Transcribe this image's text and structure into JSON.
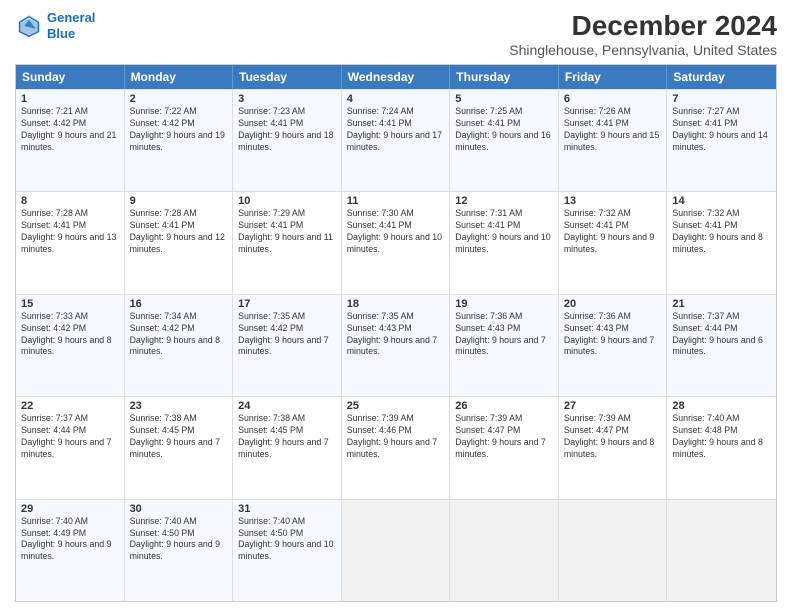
{
  "header": {
    "logo_line1": "General",
    "logo_line2": "Blue",
    "title": "December 2024",
    "subtitle": "Shinglehouse, Pennsylvania, United States"
  },
  "weekdays": [
    "Sunday",
    "Monday",
    "Tuesday",
    "Wednesday",
    "Thursday",
    "Friday",
    "Saturday"
  ],
  "weeks": [
    [
      {
        "day": "1",
        "sunrise": "Sunrise: 7:21 AM",
        "sunset": "Sunset: 4:42 PM",
        "daylight": "Daylight: 9 hours and 21 minutes."
      },
      {
        "day": "2",
        "sunrise": "Sunrise: 7:22 AM",
        "sunset": "Sunset: 4:42 PM",
        "daylight": "Daylight: 9 hours and 19 minutes."
      },
      {
        "day": "3",
        "sunrise": "Sunrise: 7:23 AM",
        "sunset": "Sunset: 4:41 PM",
        "daylight": "Daylight: 9 hours and 18 minutes."
      },
      {
        "day": "4",
        "sunrise": "Sunrise: 7:24 AM",
        "sunset": "Sunset: 4:41 PM",
        "daylight": "Daylight: 9 hours and 17 minutes."
      },
      {
        "day": "5",
        "sunrise": "Sunrise: 7:25 AM",
        "sunset": "Sunset: 4:41 PM",
        "daylight": "Daylight: 9 hours and 16 minutes."
      },
      {
        "day": "6",
        "sunrise": "Sunrise: 7:26 AM",
        "sunset": "Sunset: 4:41 PM",
        "daylight": "Daylight: 9 hours and 15 minutes."
      },
      {
        "day": "7",
        "sunrise": "Sunrise: 7:27 AM",
        "sunset": "Sunset: 4:41 PM",
        "daylight": "Daylight: 9 hours and 14 minutes."
      }
    ],
    [
      {
        "day": "8",
        "sunrise": "Sunrise: 7:28 AM",
        "sunset": "Sunset: 4:41 PM",
        "daylight": "Daylight: 9 hours and 13 minutes."
      },
      {
        "day": "9",
        "sunrise": "Sunrise: 7:28 AM",
        "sunset": "Sunset: 4:41 PM",
        "daylight": "Daylight: 9 hours and 12 minutes."
      },
      {
        "day": "10",
        "sunrise": "Sunrise: 7:29 AM",
        "sunset": "Sunset: 4:41 PM",
        "daylight": "Daylight: 9 hours and 11 minutes."
      },
      {
        "day": "11",
        "sunrise": "Sunrise: 7:30 AM",
        "sunset": "Sunset: 4:41 PM",
        "daylight": "Daylight: 9 hours and 10 minutes."
      },
      {
        "day": "12",
        "sunrise": "Sunrise: 7:31 AM",
        "sunset": "Sunset: 4:41 PM",
        "daylight": "Daylight: 9 hours and 10 minutes."
      },
      {
        "day": "13",
        "sunrise": "Sunrise: 7:32 AM",
        "sunset": "Sunset: 4:41 PM",
        "daylight": "Daylight: 9 hours and 9 minutes."
      },
      {
        "day": "14",
        "sunrise": "Sunrise: 7:32 AM",
        "sunset": "Sunset: 4:41 PM",
        "daylight": "Daylight: 9 hours and 8 minutes."
      }
    ],
    [
      {
        "day": "15",
        "sunrise": "Sunrise: 7:33 AM",
        "sunset": "Sunset: 4:42 PM",
        "daylight": "Daylight: 9 hours and 8 minutes."
      },
      {
        "day": "16",
        "sunrise": "Sunrise: 7:34 AM",
        "sunset": "Sunset: 4:42 PM",
        "daylight": "Daylight: 9 hours and 8 minutes."
      },
      {
        "day": "17",
        "sunrise": "Sunrise: 7:35 AM",
        "sunset": "Sunset: 4:42 PM",
        "daylight": "Daylight: 9 hours and 7 minutes."
      },
      {
        "day": "18",
        "sunrise": "Sunrise: 7:35 AM",
        "sunset": "Sunset: 4:43 PM",
        "daylight": "Daylight: 9 hours and 7 minutes."
      },
      {
        "day": "19",
        "sunrise": "Sunrise: 7:36 AM",
        "sunset": "Sunset: 4:43 PM",
        "daylight": "Daylight: 9 hours and 7 minutes."
      },
      {
        "day": "20",
        "sunrise": "Sunrise: 7:36 AM",
        "sunset": "Sunset: 4:43 PM",
        "daylight": "Daylight: 9 hours and 7 minutes."
      },
      {
        "day": "21",
        "sunrise": "Sunrise: 7:37 AM",
        "sunset": "Sunset: 4:44 PM",
        "daylight": "Daylight: 9 hours and 6 minutes."
      }
    ],
    [
      {
        "day": "22",
        "sunrise": "Sunrise: 7:37 AM",
        "sunset": "Sunset: 4:44 PM",
        "daylight": "Daylight: 9 hours and 7 minutes."
      },
      {
        "day": "23",
        "sunrise": "Sunrise: 7:38 AM",
        "sunset": "Sunset: 4:45 PM",
        "daylight": "Daylight: 9 hours and 7 minutes."
      },
      {
        "day": "24",
        "sunrise": "Sunrise: 7:38 AM",
        "sunset": "Sunset: 4:45 PM",
        "daylight": "Daylight: 9 hours and 7 minutes."
      },
      {
        "day": "25",
        "sunrise": "Sunrise: 7:39 AM",
        "sunset": "Sunset: 4:46 PM",
        "daylight": "Daylight: 9 hours and 7 minutes."
      },
      {
        "day": "26",
        "sunrise": "Sunrise: 7:39 AM",
        "sunset": "Sunset: 4:47 PM",
        "daylight": "Daylight: 9 hours and 7 minutes."
      },
      {
        "day": "27",
        "sunrise": "Sunrise: 7:39 AM",
        "sunset": "Sunset: 4:47 PM",
        "daylight": "Daylight: 9 hours and 8 minutes."
      },
      {
        "day": "28",
        "sunrise": "Sunrise: 7:40 AM",
        "sunset": "Sunset: 4:48 PM",
        "daylight": "Daylight: 9 hours and 8 minutes."
      }
    ],
    [
      {
        "day": "29",
        "sunrise": "Sunrise: 7:40 AM",
        "sunset": "Sunset: 4:49 PM",
        "daylight": "Daylight: 9 hours and 9 minutes."
      },
      {
        "day": "30",
        "sunrise": "Sunrise: 7:40 AM",
        "sunset": "Sunset: 4:50 PM",
        "daylight": "Daylight: 9 hours and 9 minutes."
      },
      {
        "day": "31",
        "sunrise": "Sunrise: 7:40 AM",
        "sunset": "Sunset: 4:50 PM",
        "daylight": "Daylight: 9 hours and 10 minutes."
      },
      null,
      null,
      null,
      null
    ]
  ]
}
